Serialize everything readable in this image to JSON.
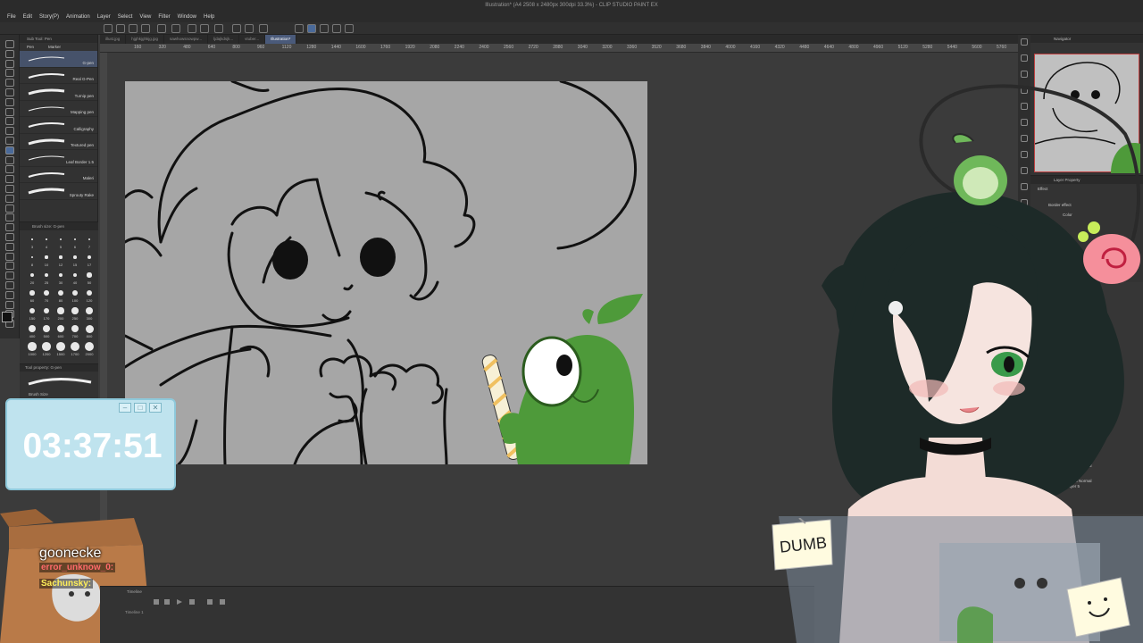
{
  "window": {
    "title": "Illustration* (A4 2508 x 2480px 300dpi 33.3%) - CLIP STUDIO PAINT EX"
  },
  "menu": [
    "File",
    "Edit",
    "Story(P)",
    "Animation",
    "Layer",
    "Select",
    "View",
    "Filter",
    "Window",
    "Help"
  ],
  "document_tabs": [
    {
      "label": "illust.jpg",
      "active": false
    },
    {
      "label": "hjghkjghkjg.jpg",
      "active": false
    },
    {
      "label": "sawhowsnowpw...",
      "active": false
    },
    {
      "label": "ljdajkdsjk...",
      "active": false
    },
    {
      "label": "vtuber...",
      "active": false
    },
    {
      "label": "Illustration*",
      "active": true
    }
  ],
  "ruler_ticks": [
    "160",
    "320",
    "480",
    "640",
    "800",
    "960",
    "1120",
    "1280",
    "1440",
    "1600",
    "1760",
    "1920",
    "2080",
    "2240",
    "2400",
    "2560",
    "2720",
    "2880",
    "3040",
    "3200",
    "3360",
    "3520",
    "3680",
    "3840",
    "4000",
    "4160",
    "4320",
    "4480",
    "4640",
    "4800",
    "4960",
    "5120",
    "5280",
    "5440",
    "5600",
    "5760"
  ],
  "subtool": {
    "header": "Sub Tool: Pen",
    "tabs": [
      "Pen",
      "Marker"
    ],
    "brushes": [
      {
        "label": "G-pen",
        "selected": true
      },
      {
        "label": "Real G-Pen",
        "selected": false
      },
      {
        "label": "Turnip pen",
        "selected": false
      },
      {
        "label": "Mapping pen",
        "selected": false
      },
      {
        "label": "Calligraphy",
        "selected": false
      },
      {
        "label": "Textured pen",
        "selected": false
      },
      {
        "label": "Leaf Border 1.5",
        "selected": false
      },
      {
        "label": "Maleri",
        "selected": false
      },
      {
        "label": "Sprouty Rake",
        "selected": false
      }
    ]
  },
  "brush_size": {
    "header": "Brush size: G-pen",
    "rows": [
      [
        "3",
        "4",
        "5",
        "6",
        "7"
      ],
      [
        "8",
        "10",
        "12",
        "15",
        "17"
      ],
      [
        "20",
        "25",
        "30",
        "40",
        "50"
      ],
      [
        "60",
        "70",
        "80",
        "100",
        "120"
      ],
      [
        "150",
        "170",
        "200",
        "250",
        "300"
      ],
      [
        "400",
        "500",
        "600",
        "700",
        "800"
      ],
      [
        "1000",
        "1200",
        "1500",
        "1700",
        "2000"
      ]
    ]
  },
  "tool_property": {
    "header": "Tool property: G-pen",
    "field": "Brush Size"
  },
  "timer": {
    "time": "03:37:51"
  },
  "chat": {
    "username": "goonecke",
    "line1": "error_unknow_0:",
    "line2": "Sachunsky:"
  },
  "timeline": {
    "header": "Timeline",
    "track": "Timeline 1"
  },
  "navigator": {
    "header": "Navigator",
    "zoom": "33.3"
  },
  "layer_property": {
    "header": "Layer Property",
    "effect": "Effect",
    "border": "Border effect",
    "color": "Color"
  },
  "layers": [
    {
      "line1": "100 % Normal",
      "line2": "Layer 6"
    },
    {
      "line1": "100 % Normal",
      "line2": "Layer 5"
    }
  ],
  "sticky_notes": {
    "left": "DUMB"
  },
  "colors": {
    "canvas_bg": "#a6a6a6",
    "frog_green": "#4e9a3a",
    "timer_bg": "#bfe3ee",
    "panel": "#333333"
  }
}
